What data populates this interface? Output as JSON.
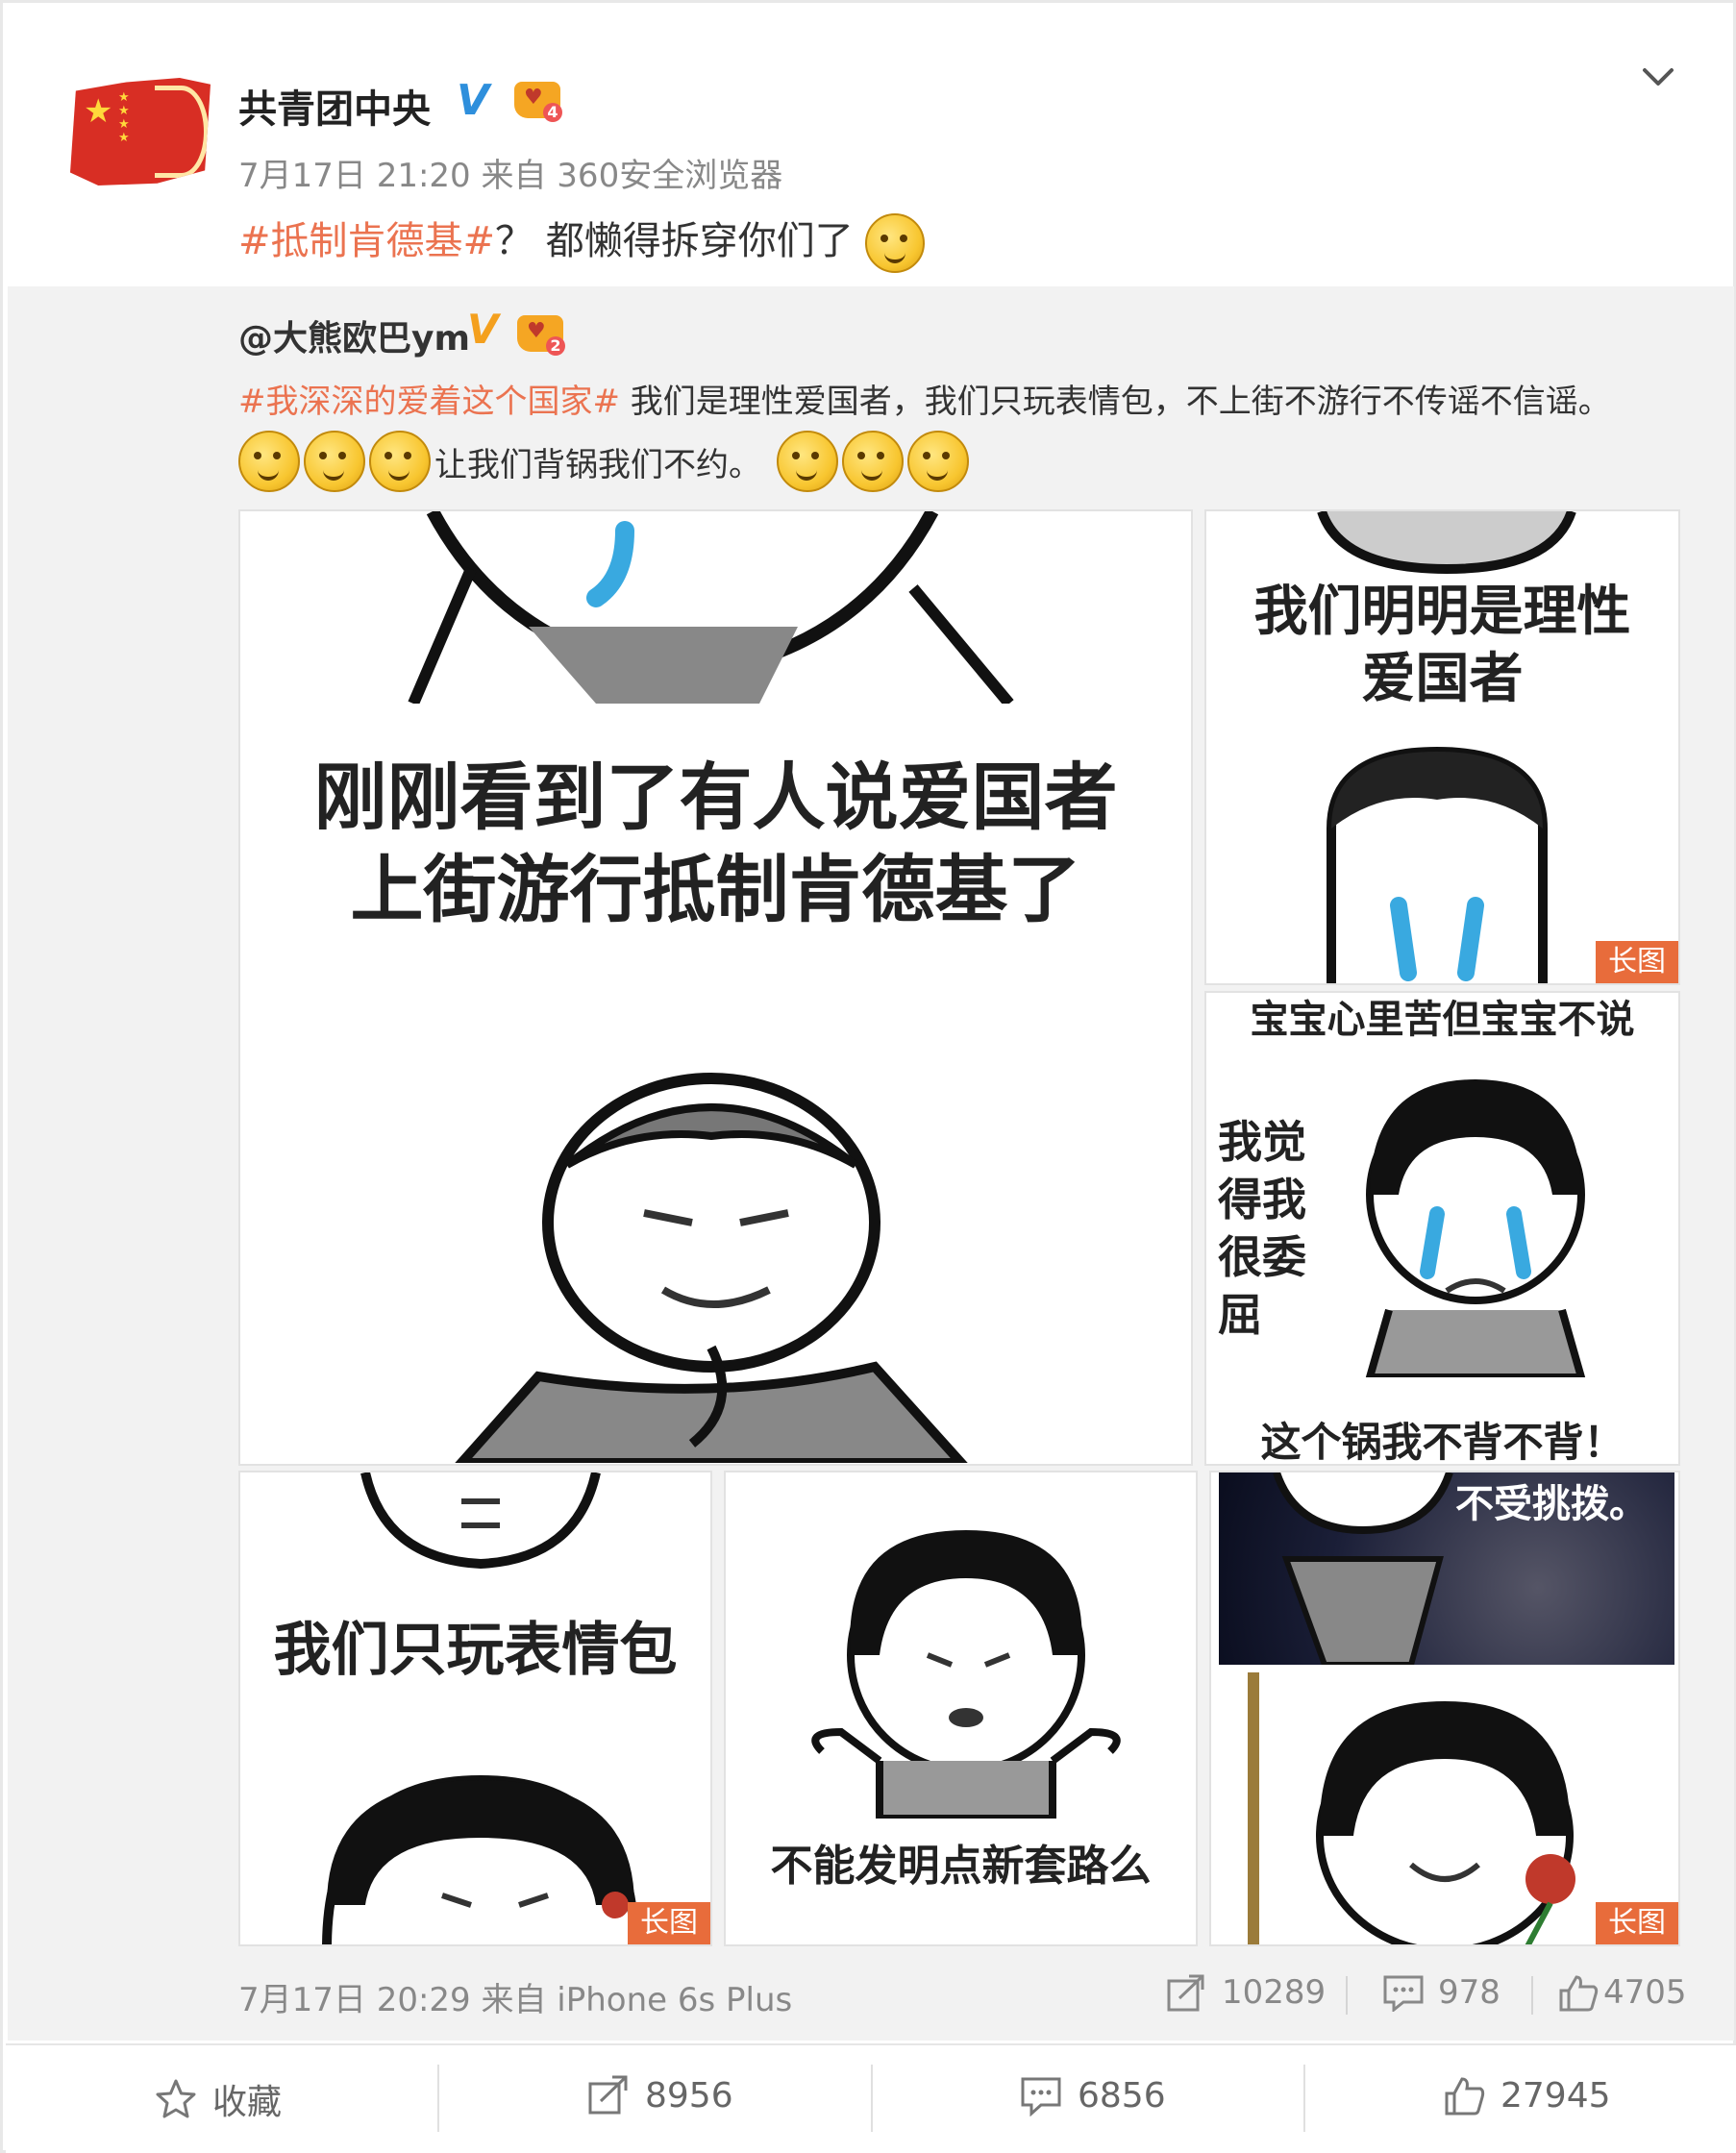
{
  "post": {
    "author": "共青团中央",
    "meta": "7月17日 21:20 来自 360安全浏览器",
    "hashtag": "#抵制肯德基#",
    "text": "？ 都懒得拆穿你们了",
    "badge_level": "4"
  },
  "repost": {
    "author": "@大熊欧巴ym",
    "badge_level": "2",
    "hashtag": "#我深深的爱着这个国家#",
    "text_line1": " 我们是理性爱国者，我们只玩表情包，不上街不游行不传谣不信谣。",
    "text_line2": "让我们背锅我们不约。",
    "images": [
      {
        "caption": "刚刚看到了有人说爱国者 上街游行抵制肯德基了",
        "line1": "刚刚看到了有人说爱国者",
        "line2": "上街游行抵制肯德基了"
      },
      {
        "line1": "我们明明是理性",
        "line2": "爱国者",
        "tag": "长图"
      },
      {
        "line1": "宝宝心里苦但宝宝不说",
        "side": [
          "我觉",
          "得我",
          "很委",
          "屈"
        ],
        "bottom": "这个锅我不背不背！"
      },
      {
        "line1": "我们只玩表情包",
        "tag": "长图"
      },
      {
        "line1": "不能发明点新套路么"
      },
      {
        "line1": "不受挑拨。",
        "tag": "长图"
      }
    ],
    "meta": "7月17日 20:29 来自 iPhone 6s Plus",
    "stats": {
      "forward": "10289",
      "comment": "978",
      "like": "4705"
    }
  },
  "actions": {
    "favorite": "收藏",
    "forward": "8956",
    "comment": "6856",
    "like": "27945"
  },
  "colors": {
    "hashtag": "#eb7350",
    "verified_blue": "#2e8fdc",
    "verified_gold": "#f4a01e",
    "long_image_tag": "#e86c3b"
  },
  "icons": [
    "chevron-down-icon",
    "verified-icon",
    "crown-badge-icon",
    "smirk-emoji-icon",
    "forward-icon",
    "comment-icon",
    "like-icon",
    "star-icon"
  ]
}
